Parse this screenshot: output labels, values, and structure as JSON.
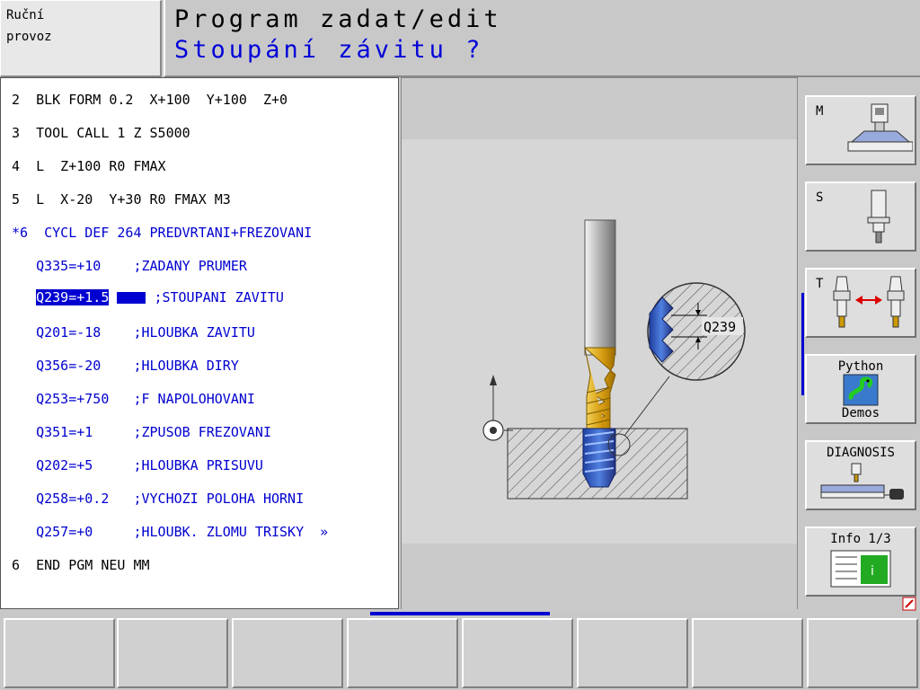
{
  "mode": {
    "line1": "Ruční",
    "line2": "provoz"
  },
  "header": {
    "title": "Program zadat/edit",
    "prompt": "Stoupání závitu ?"
  },
  "program_lines": [
    {
      "text": "2  BLK FORM 0.2  X+100  Y+100  Z+0",
      "style": "black"
    },
    {
      "text": "3  TOOL CALL 1 Z S5000",
      "style": "black"
    },
    {
      "text": "4  L  Z+100 R0 FMAX",
      "style": "black"
    },
    {
      "text": "5  L  X-20  Y+30 R0 FMAX M3",
      "style": "black"
    },
    {
      "text": "*6  CYCL DEF 264 PREDVRTANI+FREZOVANI",
      "style": "blue"
    },
    {
      "text": "   Q335=+10    ;ZADANY PRUMER",
      "style": "blue"
    },
    {
      "text": "",
      "style": "blue"
    },
    {
      "text": "   Q201=-18    ;HLOUBKA ZAVITU",
      "style": "blue"
    },
    {
      "text": "   Q356=-20    ;HLOUBKA DIRY",
      "style": "blue"
    },
    {
      "text": "   Q253=+750   ;F NAPOLOHOVANI",
      "style": "blue"
    },
    {
      "text": "   Q351=+1     ;ZPUSOB FREZOVANI",
      "style": "blue"
    },
    {
      "text": "   Q202=+5     ;HLOUBKA PRISUVU",
      "style": "blue"
    },
    {
      "text": "   Q258=+0.2   ;VYCHOZI POLOHA HORNI",
      "style": "blue"
    },
    {
      "text": "   Q257=+0     ;HLOUBK. ZLOMU TRISKY  »",
      "style": "blue"
    },
    {
      "text": "6  END PGM NEU MM",
      "style": "black"
    }
  ],
  "active_line": {
    "indent": "   ",
    "highlighted": "Q239=+1.5",
    "comment": ";STOUPANI ZAVITU"
  },
  "graphic": {
    "q_label": "Q239"
  },
  "side_keys": {
    "m": "M",
    "s": "S",
    "t": "T",
    "python_top": "Python",
    "python_bottom": "Demos",
    "diagnosis": "DIAGNOSIS",
    "info": "Info 1/3",
    "info_glyph": "i"
  },
  "colors": {
    "accent": "#0000d0",
    "tool_gold": "#e0b020",
    "thread_blue": "#3060c0"
  }
}
